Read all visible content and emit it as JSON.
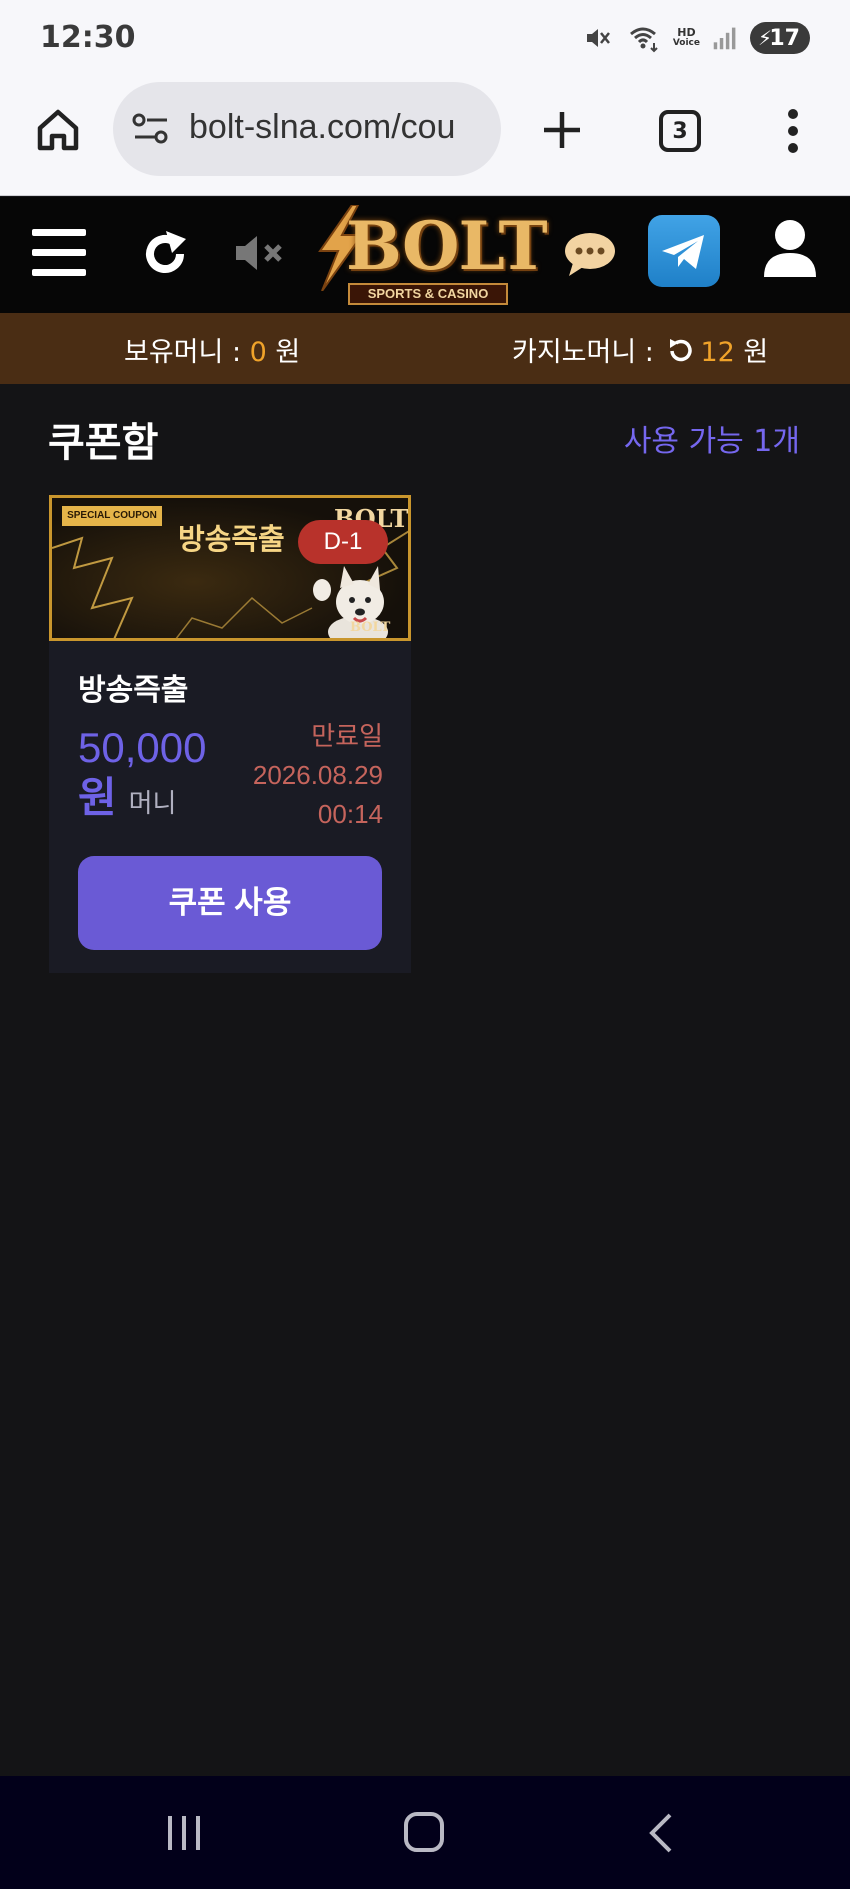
{
  "status_bar": {
    "time": "12:30",
    "hd_top": "HD",
    "hd_bottom": "Voice",
    "battery": "17",
    "icons": [
      "mute-icon",
      "wifi-icon",
      "hd-voice-icon",
      "signal-icon",
      "battery-charging-icon"
    ]
  },
  "browser": {
    "url": "bolt-slna.com/cou",
    "tab_count": "3"
  },
  "site_header": {
    "logo_text": "BOLT",
    "logo_sub": "SPORTS & CASINO",
    "icons": [
      "menu-icon",
      "refresh-icon",
      "sound-off-icon",
      "chat-icon",
      "telegram-icon",
      "user-icon"
    ]
  },
  "balance": {
    "holding_label": "보유머니 : ",
    "holding_value": "0",
    "holding_unit": " 원",
    "casino_label": "카지노머니 :",
    "casino_value": "12",
    "casino_unit": " 원",
    "value_color": "#f0a32a"
  },
  "coupon_page": {
    "title": "쿠폰함",
    "available": "사용 가능 1개",
    "accent_color": "#7567ee",
    "coupons": [
      {
        "banner_tag": "SPECIAL COUPON",
        "banner_title": "방송즉출",
        "banner_logo": "BOLT",
        "banner_logo_small": "BOLT",
        "dday": "D-1",
        "name": "방송즉출",
        "amount": "50,000",
        "amount_won": "원",
        "amount_unit": "머니",
        "expiry_label": "만료일",
        "expiry_date": "2026.08.29",
        "expiry_time": "00:14",
        "button_label": "쿠폰 사용"
      }
    ]
  },
  "nav_bar": {
    "icons": [
      "recent-apps-icon",
      "home-icon",
      "back-icon"
    ]
  }
}
